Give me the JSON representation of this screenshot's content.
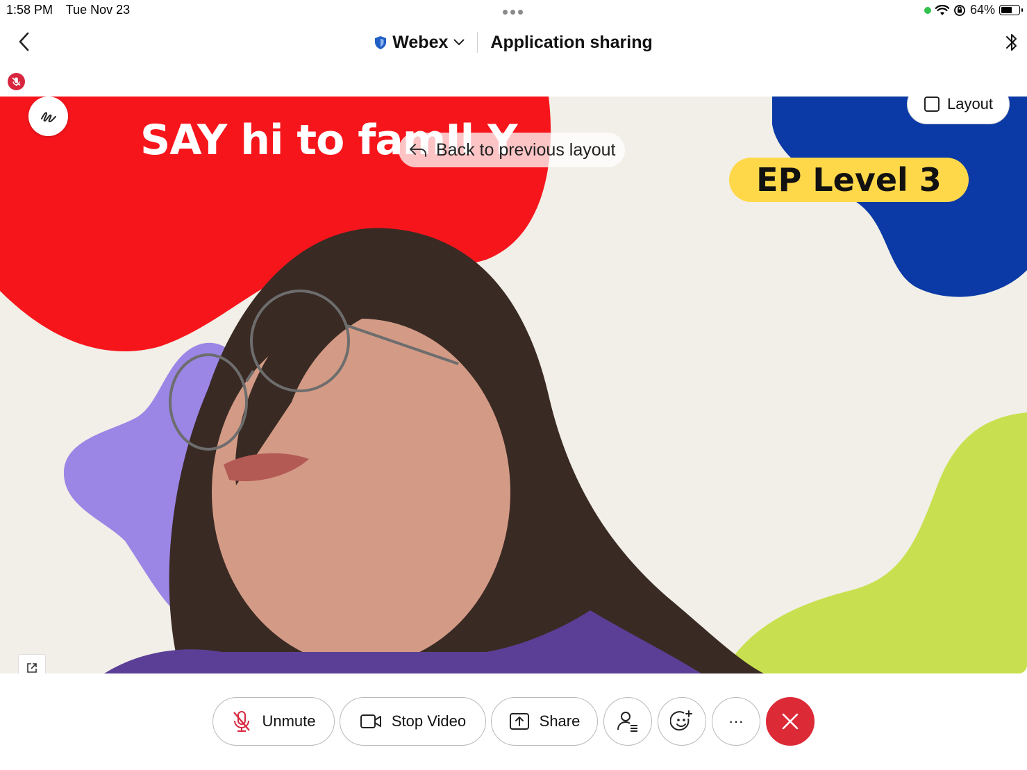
{
  "status_bar": {
    "time": "1:58 PM",
    "date": "Tue Nov 23",
    "battery": "64%",
    "battery_level": 0.64
  },
  "header": {
    "brand": "Webex",
    "title": "Application sharing"
  },
  "video": {
    "slide_text": "SAY hi to famIl Y",
    "badge_text": "EP Level 3",
    "back_layout_label": "Back to previous layout",
    "layout_label": "Layout"
  },
  "controls": {
    "unmute_label": "Unmute",
    "stop_video_label": "Stop Video",
    "share_label": "Share",
    "more_label": "···"
  },
  "colors": {
    "end_call": "#dc2a37",
    "mic_off": "#d7263d",
    "brand_shield": "#1f5fc6"
  },
  "icons": [
    "back-chevron-icon",
    "shield-icon",
    "chevron-down-icon",
    "bluetooth-icon",
    "mic-off-icon",
    "annotate-icon",
    "undo-arrow-icon",
    "layout-square-icon",
    "popout-icon",
    "video-camera-icon",
    "share-upload-icon",
    "participants-icon",
    "reaction-icon",
    "more-icon",
    "close-icon"
  ]
}
